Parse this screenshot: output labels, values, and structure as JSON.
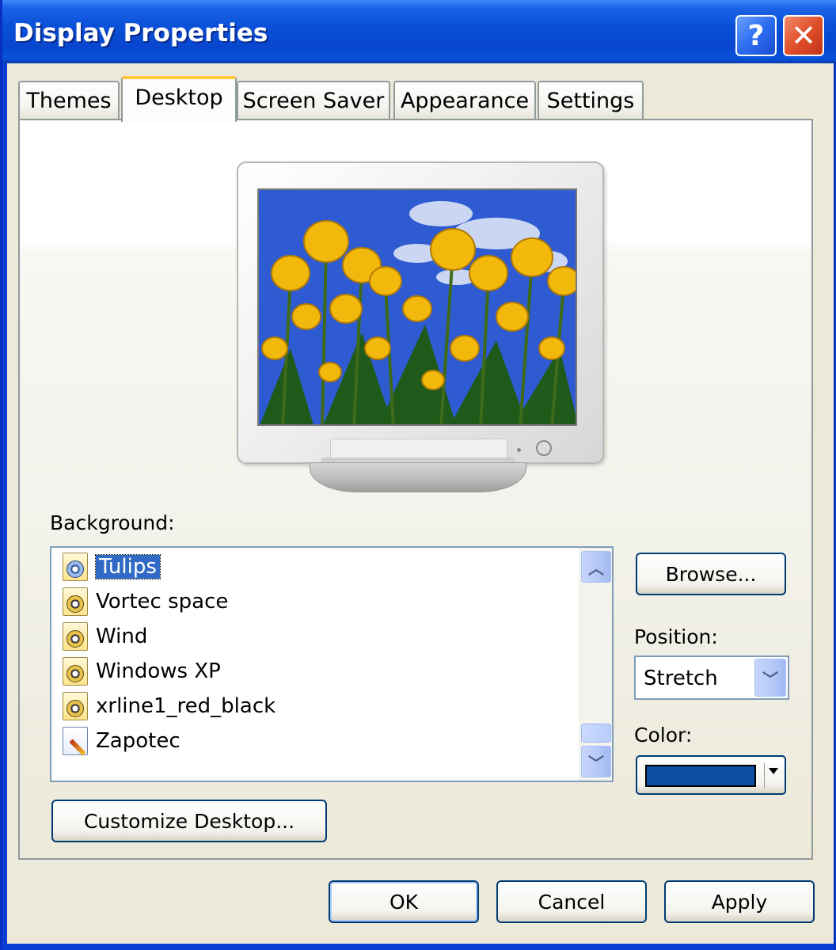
{
  "window": {
    "title": "Display Properties"
  },
  "titlebar": {
    "help_glyph": "?",
    "close_glyph": "✕"
  },
  "tabs": [
    {
      "label": "Themes",
      "active": false
    },
    {
      "label": "Desktop",
      "active": true
    },
    {
      "label": "Screen Saver",
      "active": false
    },
    {
      "label": "Appearance",
      "active": false
    },
    {
      "label": "Settings",
      "active": false
    }
  ],
  "desktop": {
    "background_label": "Background:",
    "background_items": [
      {
        "label": "Tulips",
        "icon": "image-file-icon",
        "selected": true
      },
      {
        "label": "Vortec space",
        "icon": "image-file-icon",
        "selected": false
      },
      {
        "label": "Wind",
        "icon": "image-file-icon",
        "selected": false
      },
      {
        "label": "Windows XP",
        "icon": "image-file-icon",
        "selected": false
      },
      {
        "label": "xrline1_red_black",
        "icon": "image-file-icon",
        "selected": false
      },
      {
        "label": "Zapotec",
        "icon": "paint-file-icon",
        "selected": false
      }
    ],
    "browse_label": "Browse...",
    "position_label": "Position:",
    "position_value": "Stretch",
    "color_label": "Color:",
    "color_value": "#0b4ea2",
    "customize_label": "Customize Desktop..."
  },
  "footer": {
    "ok_label": "OK",
    "cancel_label": "Cancel",
    "apply_label": "Apply"
  },
  "colors": {
    "title_bar": "#0a51d8",
    "dialog_bg": "#ece9d8",
    "selection": "#316ac5",
    "active_tab_accent": "#ffc83c"
  }
}
